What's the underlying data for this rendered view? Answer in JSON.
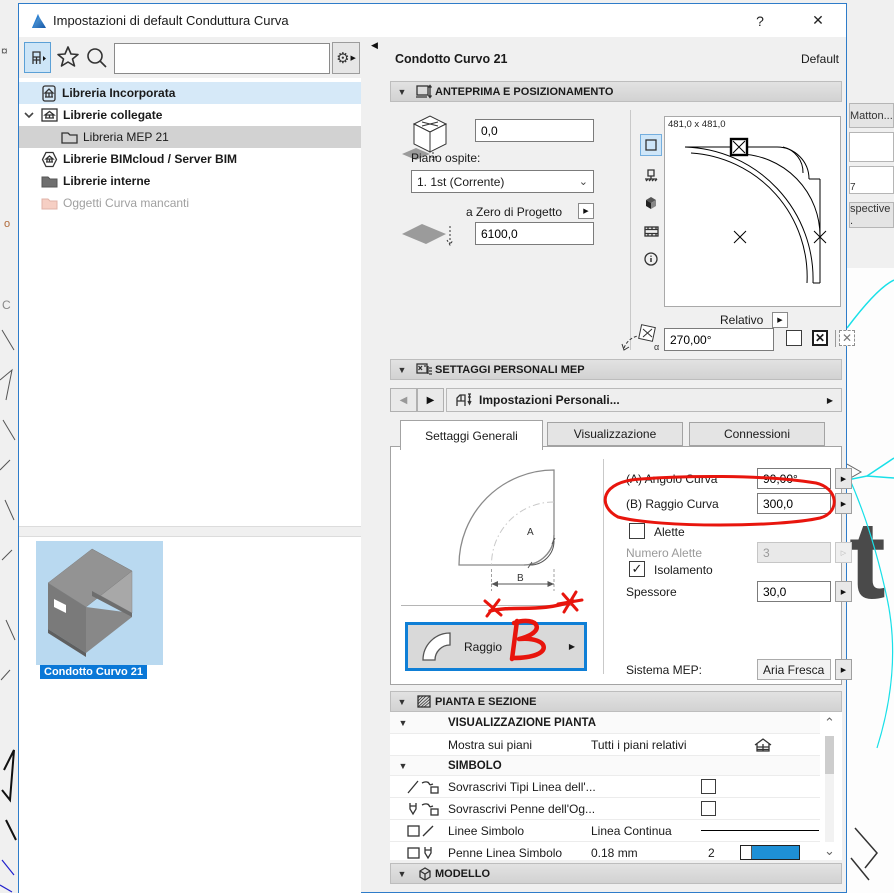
{
  "colors": {
    "accent": "#0a78d7",
    "annotation_red": "#e8150d",
    "selection_blue": "#d6e9f8",
    "focus_blue": "#0f7fd6"
  },
  "window": {
    "title": "Impostazioni di default Conduttura Curva",
    "help": "?",
    "close": "✕"
  },
  "background": {
    "left_mark_1": "¤",
    "left_mark_2": "o",
    "left_mark_3": "C",
    "right_field_1": "Matton...",
    "right_field_2": "7",
    "right_field_3": "spective .",
    "right_letter": "t"
  },
  "library": {
    "search_value": "",
    "tree": [
      {
        "label": "Libreria Incorporata"
      },
      {
        "label": "Librerie collegate"
      },
      {
        "label": "Libreria MEP 21"
      },
      {
        "label": "Librerie BIMcloud / Server BIM"
      },
      {
        "label": "Librerie interne"
      },
      {
        "label": "Oggetti Curva mancanti"
      }
    ],
    "selected_object": "Condotto Curvo 21"
  },
  "header": {
    "object_name": "Condotto Curvo 21",
    "state": "Default"
  },
  "preview": {
    "section_title": "ANTEPRIMA E POSIZIONAMENTO",
    "offset_value": "0,0",
    "host_label": "Piano ospite:",
    "host_value": "1. 1st (Corrente)",
    "zero_label": "a Zero di Progetto",
    "elevation_value": "6100,0",
    "size_label": "481,0 x 481,0",
    "relative_label": "Relativo",
    "rotation_value": "270,00°"
  },
  "mep": {
    "section_title": "SETTAGGI PERSONALI MEP",
    "nav_label": "Impostazioni Personali...",
    "tabs": [
      {
        "label": "Settaggi Generali"
      },
      {
        "label": "Visualizzazione"
      },
      {
        "label": "Connessioni"
      }
    ],
    "angle_label": "(A) Angolo Curva",
    "angle_value": "90,00°",
    "radius_label": "(B) Raggio Curva",
    "radius_value": "300,0",
    "vanes_label": "Alette",
    "vanes_count_label": "Numero Alette",
    "vanes_count_value": "3",
    "insulation_label": "Isolamento",
    "thickness_label": "Spessore",
    "thickness_value": "30,0",
    "system_label": "Sistema MEP:",
    "system_value": "Aria Fresca",
    "dim_a": "A",
    "dim_b": "B",
    "radius_type_label": "Raggio",
    "annotation_letter": "B"
  },
  "plan": {
    "section_title": "PIANTA E SEZIONE",
    "group1": "VISUALIZZAZIONE PIANTA",
    "row_show_label": "Mostra sui piani",
    "row_show_value": "Tutti i piani relativi",
    "group2": "SIMBOLO",
    "row_linetypes_label": "Sovrascrivi Tipi Linea dell'...",
    "row_pens_label": "Sovrascrivi Penne dell'Og...",
    "row_symbol_lines_label": "Linee Simbolo",
    "row_symbol_lines_value": "Linea Continua",
    "row_symbol_pen_label": "Penne Linea Simbolo",
    "row_symbol_pen_value": "0.18 mm",
    "row_symbol_pen_num": "2"
  },
  "model": {
    "section_title": "MODELLO"
  }
}
